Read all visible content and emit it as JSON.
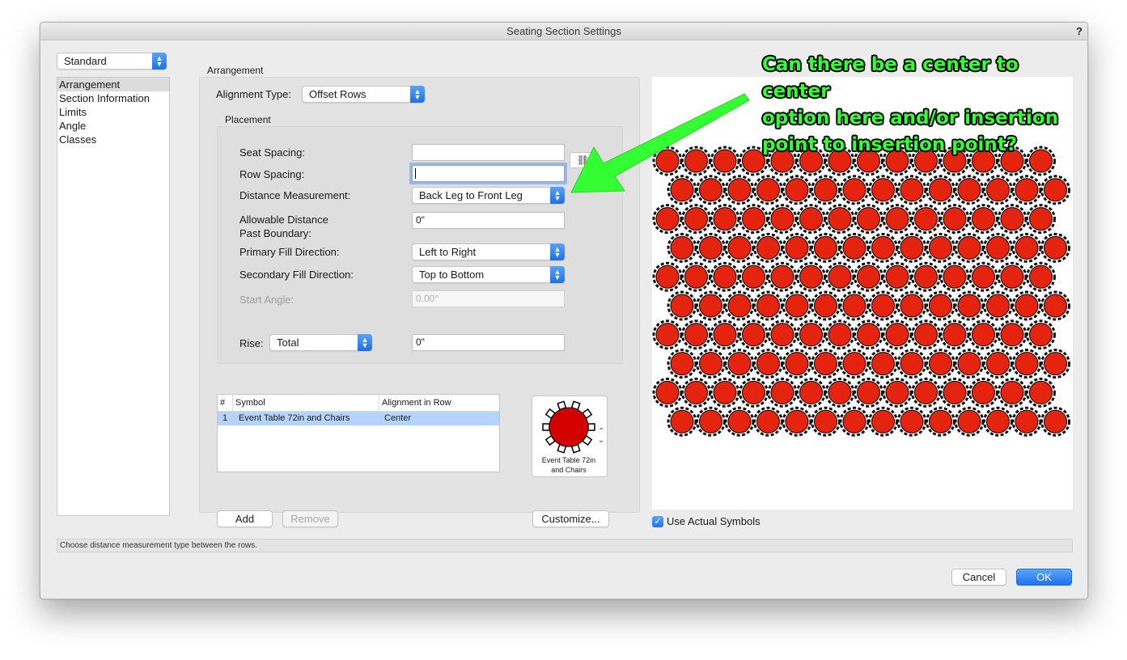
{
  "window": {
    "title": "Seating Section Settings",
    "help": "?"
  },
  "preset": {
    "value": "Standard"
  },
  "sidebar": {
    "items": [
      {
        "label": "Arrangement"
      },
      {
        "label": "Section Information"
      },
      {
        "label": "Limits"
      },
      {
        "label": "Angle"
      },
      {
        "label": "Classes"
      }
    ]
  },
  "arrangement": {
    "heading": "Arrangement",
    "alignment_type_label": "Alignment Type:",
    "alignment_type_value": "Offset Rows",
    "placement_heading": "Placement",
    "seat_spacing_label": "Seat Spacing:",
    "seat_spacing_value": "",
    "row_spacing_label": "Row Spacing:",
    "row_spacing_value": "",
    "distance_measurement_label": "Distance Measurement:",
    "distance_measurement_value": "Back Leg to Front Leg",
    "allowable_distance_label_1": "Allowable Distance",
    "allowable_distance_label_2": "Past Boundary:",
    "allowable_distance_value": "0\"",
    "primary_fill_label": "Primary Fill Direction:",
    "primary_fill_value": "Left to Right",
    "secondary_fill_label": "Secondary Fill Direction:",
    "secondary_fill_value": "Top to Bottom",
    "start_angle_label": "Start Angle:",
    "start_angle_value": "0.00°",
    "rise_label": "Rise:",
    "rise_type_value": "Total",
    "rise_value": "0\""
  },
  "symbols_table": {
    "columns": [
      "#",
      "Symbol",
      "Alignment in Row"
    ],
    "rows": [
      {
        "num": "1",
        "symbol": "Event Table 72in and Chairs",
        "alignment": "Center"
      }
    ]
  },
  "symbol_preview": {
    "caption_1": "Event Table 72in",
    "caption_2": "and Chairs"
  },
  "buttons": {
    "add": "Add",
    "remove": "Remove",
    "customize": "Customize...",
    "cancel": "Cancel",
    "ok": "OK"
  },
  "use_actual_symbols": {
    "label": "Use Actual Symbols",
    "checked": true
  },
  "status": {
    "text": "Choose distance measurement type between the rows."
  },
  "annotation": {
    "line_1": "Can there be a center to center",
    "line_2": "option here and/or insertion",
    "line_3": "point to insertion point?"
  },
  "preview_grid": {
    "rows": 10,
    "seats_per_row": 14,
    "table_color": "#e52410",
    "chair_color": "#111111"
  },
  "colors": {
    "accent": "#1f72ea",
    "annotation": "#33ff33"
  }
}
